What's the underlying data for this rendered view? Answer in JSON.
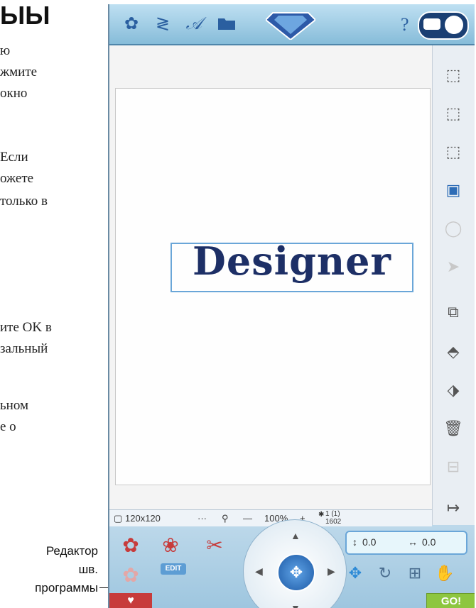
{
  "manual": {
    "title": "ЫЫ",
    "lines": [
      "ю",
      "жмите",
      "окно",
      "Если",
      "ожете",
      "только в",
      "ите OK в",
      "зальный",
      "ьном",
      "е о"
    ],
    "callout": [
      "Редактор",
      "шв.",
      "программы"
    ]
  },
  "topbar": {
    "icons": [
      "flower-icon",
      "zigzag-icon",
      "script-a-icon",
      "folder-icon",
      "diamond-logo",
      "help-icon",
      "home-toggle-icon"
    ],
    "help_label": "?"
  },
  "canvas": {
    "design_text": "Designer"
  },
  "sidebar": {
    "icons": [
      "select-next-icon",
      "select-group-icon",
      "select-area-icon",
      "copy-selection-icon",
      "lasso-icon-dim",
      "arrow-icon-dim",
      "duplicate-icon",
      "mirror-vertical-icon",
      "mirror-horizontal-icon",
      "delete-icon",
      "trash-icon-dim",
      "exit-icon"
    ]
  },
  "status": {
    "hoop": "120x120",
    "dots": "···",
    "zoom_minus": "—",
    "zoom": "100%",
    "zoom_plus": "+",
    "count1": "1 (1)",
    "count2": "1602"
  },
  "panel": {
    "edit_label": "EDIT",
    "coord_y": "0.0",
    "coord_x": "0.0",
    "go_label": "GO!"
  },
  "colors": {
    "accent": "#2d6cb6",
    "go": "#8dc63f",
    "heart": "#c73b3b",
    "design": "#1d2f66"
  }
}
